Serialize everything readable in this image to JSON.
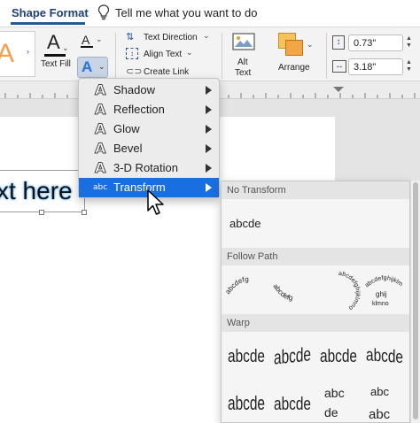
{
  "tabs": {
    "active": "Shape Format",
    "tell_me": "Tell me what you want to do"
  },
  "ribbon": {
    "text_fill_label": "Text Fill",
    "text_direction": "Text Direction",
    "align_text": "Align Text",
    "create_link": "Create Link",
    "alt_text_line1": "Alt",
    "alt_text_line2": "Text",
    "arrange": "Arrange",
    "height_value": "0.73\"",
    "width_value": "3.18\""
  },
  "document": {
    "text_box": "xt here"
  },
  "effects_menu": {
    "items": [
      {
        "label": "Shadow",
        "icon": "A"
      },
      {
        "label": "Reflection",
        "icon": "A"
      },
      {
        "label": "Glow",
        "icon": "A"
      },
      {
        "label": "Bevel",
        "icon": "A"
      },
      {
        "label": "3-D Rotation",
        "icon": "A"
      },
      {
        "label": "Transform",
        "icon": "abc"
      }
    ],
    "highlighted": "Transform"
  },
  "transform_gallery": {
    "sections": {
      "no_transform": "No Transform",
      "follow_path": "Follow Path",
      "warp": "Warp"
    },
    "sample": "abcde",
    "follow_path_samples": [
      "abcdefg",
      "abcdefg",
      "abcdefghijklmno",
      "abcdefghijklmno"
    ]
  },
  "colors": {
    "accent": "#2b579a",
    "menu_highlight": "#1a6fe0",
    "glow": "#6fb6ff"
  }
}
